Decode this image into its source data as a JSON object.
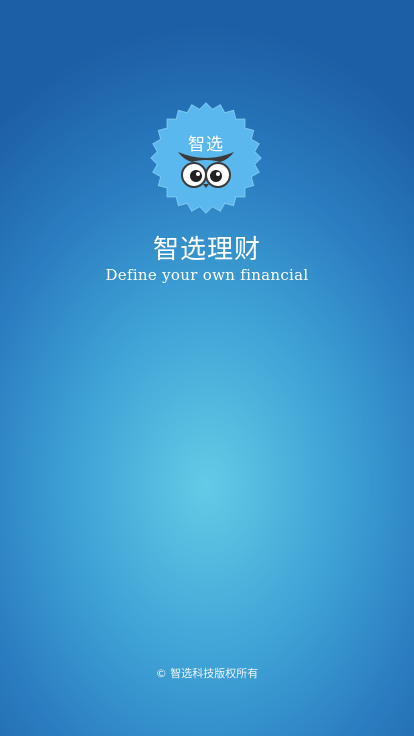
{
  "logo": {
    "text": "智选",
    "icon": "owl-eyes-icon",
    "badge_color": "#5ab8ee"
  },
  "app_title": "智选理财",
  "tagline": "Define your own financial",
  "copyright": "© 智选科技版权所有",
  "colors": {
    "bg_center": "#63cbe6",
    "bg_edge": "#1d5fa6"
  }
}
